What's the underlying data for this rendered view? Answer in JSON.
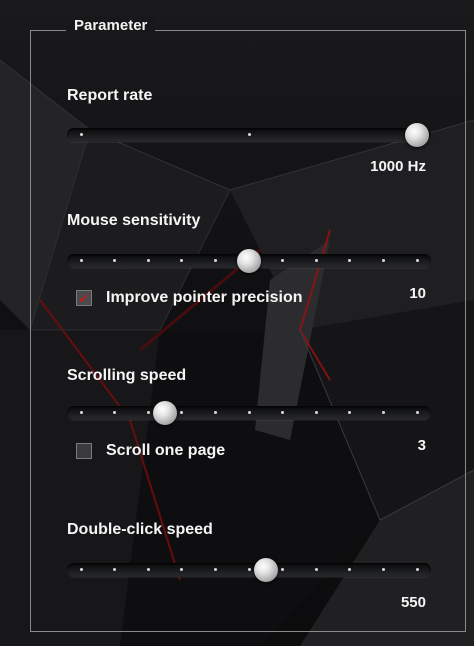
{
  "group": {
    "legend": "Parameter"
  },
  "report_rate": {
    "label": "Report rate",
    "value_text": "1000 Hz",
    "ticks": 3,
    "position": 1.0
  },
  "mouse_sensitivity": {
    "label": "Mouse sensitivity",
    "value_text": "10",
    "ticks": 11,
    "position": 0.5,
    "checkbox": {
      "label": "Improve pointer precision",
      "checked": true
    }
  },
  "scrolling_speed": {
    "label": "Scrolling speed",
    "value_text": "3",
    "ticks": 11,
    "position": 0.25,
    "checkbox": {
      "label": "Scroll one page",
      "checked": false
    }
  },
  "double_click_speed": {
    "label": "Double-click speed",
    "value_text": "550",
    "ticks": 11,
    "position": 0.55
  },
  "colors": {
    "accent": "#d01818",
    "panel_border": "#8a8a8a"
  }
}
